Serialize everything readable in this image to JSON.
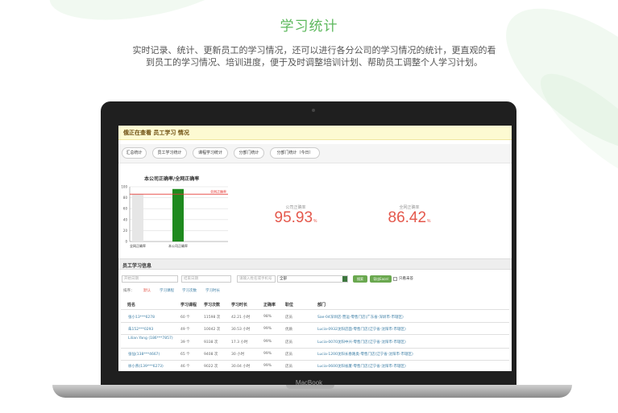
{
  "hero": {
    "title": "学习统计",
    "description": "实时记录、统计、更新员工的学习情况，还可以进行各分公司的学习情况的统计，更直观的看到员工的学习情况、培训进度，便于及时调整培训计划、帮助员工调整个人学习计划。"
  },
  "device": {
    "brand": "MacBook"
  },
  "app": {
    "banner": "俄正在查看 员工学习 情况",
    "tabs": [
      {
        "label": "汇总统计",
        "active": false
      },
      {
        "label": "员工学习统计",
        "active": true
      },
      {
        "label": "课程学习统计",
        "active": false
      },
      {
        "label": "分部门统计",
        "active": false
      },
      {
        "label": "分部门统计（今日）",
        "active": false
      }
    ],
    "stats": {
      "company": {
        "label": "公司正确率",
        "value": "95.93",
        "unit": "%"
      },
      "network": {
        "label": "全网正确率",
        "value": "86.42",
        "unit": "%"
      }
    },
    "section_title": "员工学习信息",
    "filters": {
      "start_placeholder": "开始日期",
      "end_placeholder": "结束日期",
      "search_placeholder": "请输入姓名或手机号",
      "dept_value": "全部",
      "search_button": "搜索",
      "export_button": "导出Excel",
      "checkbox_label": "只看未答"
    },
    "sort": {
      "label": "排序：",
      "options": [
        {
          "label": "默认",
          "active": true
        },
        {
          "label": "学习课程",
          "active": false
        },
        {
          "label": "学习次数",
          "active": false
        },
        {
          "label": "学习时长",
          "active": false
        }
      ]
    },
    "table": {
      "headers": [
        "姓名",
        "学习课程",
        "学习次数",
        "学习时长",
        "正确率",
        "职位",
        "部门"
      ],
      "rows": [
        {
          "name": "张小13***6278",
          "courses": "60 个",
          "times": "11598 次",
          "duration": "42.21 小时",
          "rate": "98%",
          "position": "店员",
          "dept": "Sae-04深圳店-营运-零售门店(广东省-深圳市-市辖区)"
        },
        {
          "name": "朱152***0293",
          "courses": "49 个",
          "times": "10042 次",
          "duration": "30.53 小时",
          "rate": "99%",
          "position": "优质",
          "dept": "Lucia-0932沈阳店面-零售门店(辽宁省-沈阳市-市辖区)"
        },
        {
          "name": "Lilian Yang (186***7857)",
          "courses": "39 个",
          "times": "9338 次",
          "duration": "17.3 小时",
          "rate": "99%",
          "position": "店员",
          "dept": "Lucia-0070沈阳中兴-零售门店(辽宁省-沈阳市-市辖区)"
        },
        {
          "name": "张仙(138***4667)",
          "courses": "65 个",
          "times": "9408 次",
          "duration": "30 小时",
          "rate": "99%",
          "position": "店员",
          "dept": "Lucia-1200沈阳长春路奥-零售门店(辽宁省-沈阳市-市辖区)"
        },
        {
          "name": "徐小燕(139***6273)",
          "courses": "46 个",
          "times": "9022 次",
          "duration": "30.04 小时",
          "rate": "99%",
          "position": "店员",
          "dept": "Lucia-0600沈阳省厦-零售门店(辽宁省-沈阳市-市辖区)"
        }
      ]
    }
  },
  "chart_data": {
    "type": "bar",
    "title": "本公司正确率/全网正确率",
    "categories": [
      "全网正确率",
      "本公司正确率"
    ],
    "values": [
      86.42,
      95.93
    ],
    "y_ticks": [
      0,
      20,
      40,
      60,
      80,
      100
    ],
    "ylim": [
      0,
      100
    ],
    "reference_line": {
      "label": "全网正确率",
      "value": 86.42
    },
    "colors": {
      "bar_network": "#e6e6e6",
      "bar_company": "#1e8a1e",
      "reference": "#e53935"
    },
    "grid": true
  }
}
